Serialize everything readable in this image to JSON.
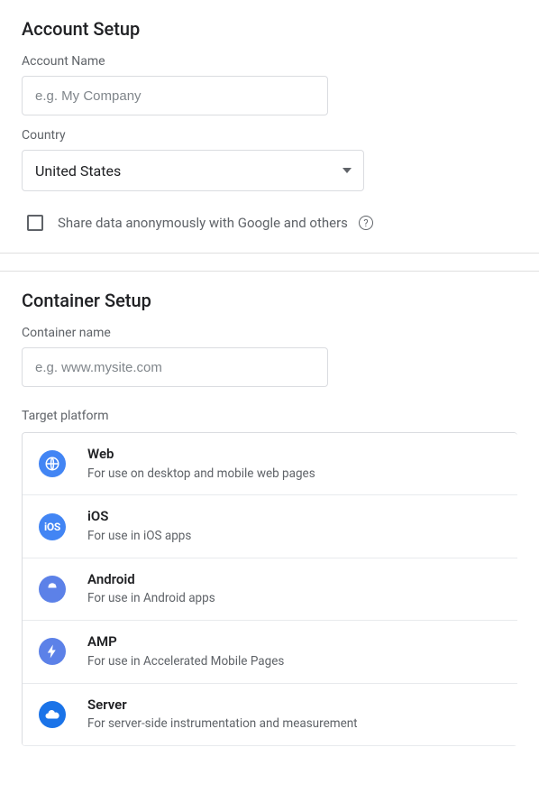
{
  "account": {
    "title": "Account Setup",
    "name_label": "Account Name",
    "name_placeholder": "e.g. My Company",
    "country_label": "Country",
    "country_value": "United States",
    "share_label": "Share data anonymously with Google and others"
  },
  "container": {
    "title": "Container Setup",
    "name_label": "Container name",
    "name_placeholder": "e.g. www.mysite.com",
    "target_label": "Target platform"
  },
  "platforms": [
    {
      "title": "Web",
      "desc": "For use on desktop and mobile web pages"
    },
    {
      "title": "iOS",
      "desc": "For use in iOS apps"
    },
    {
      "title": "Android",
      "desc": "For use in Android apps"
    },
    {
      "title": "AMP",
      "desc": "For use in Accelerated Mobile Pages"
    },
    {
      "title": "Server",
      "desc": "For server-side instrumentation and measurement"
    }
  ]
}
